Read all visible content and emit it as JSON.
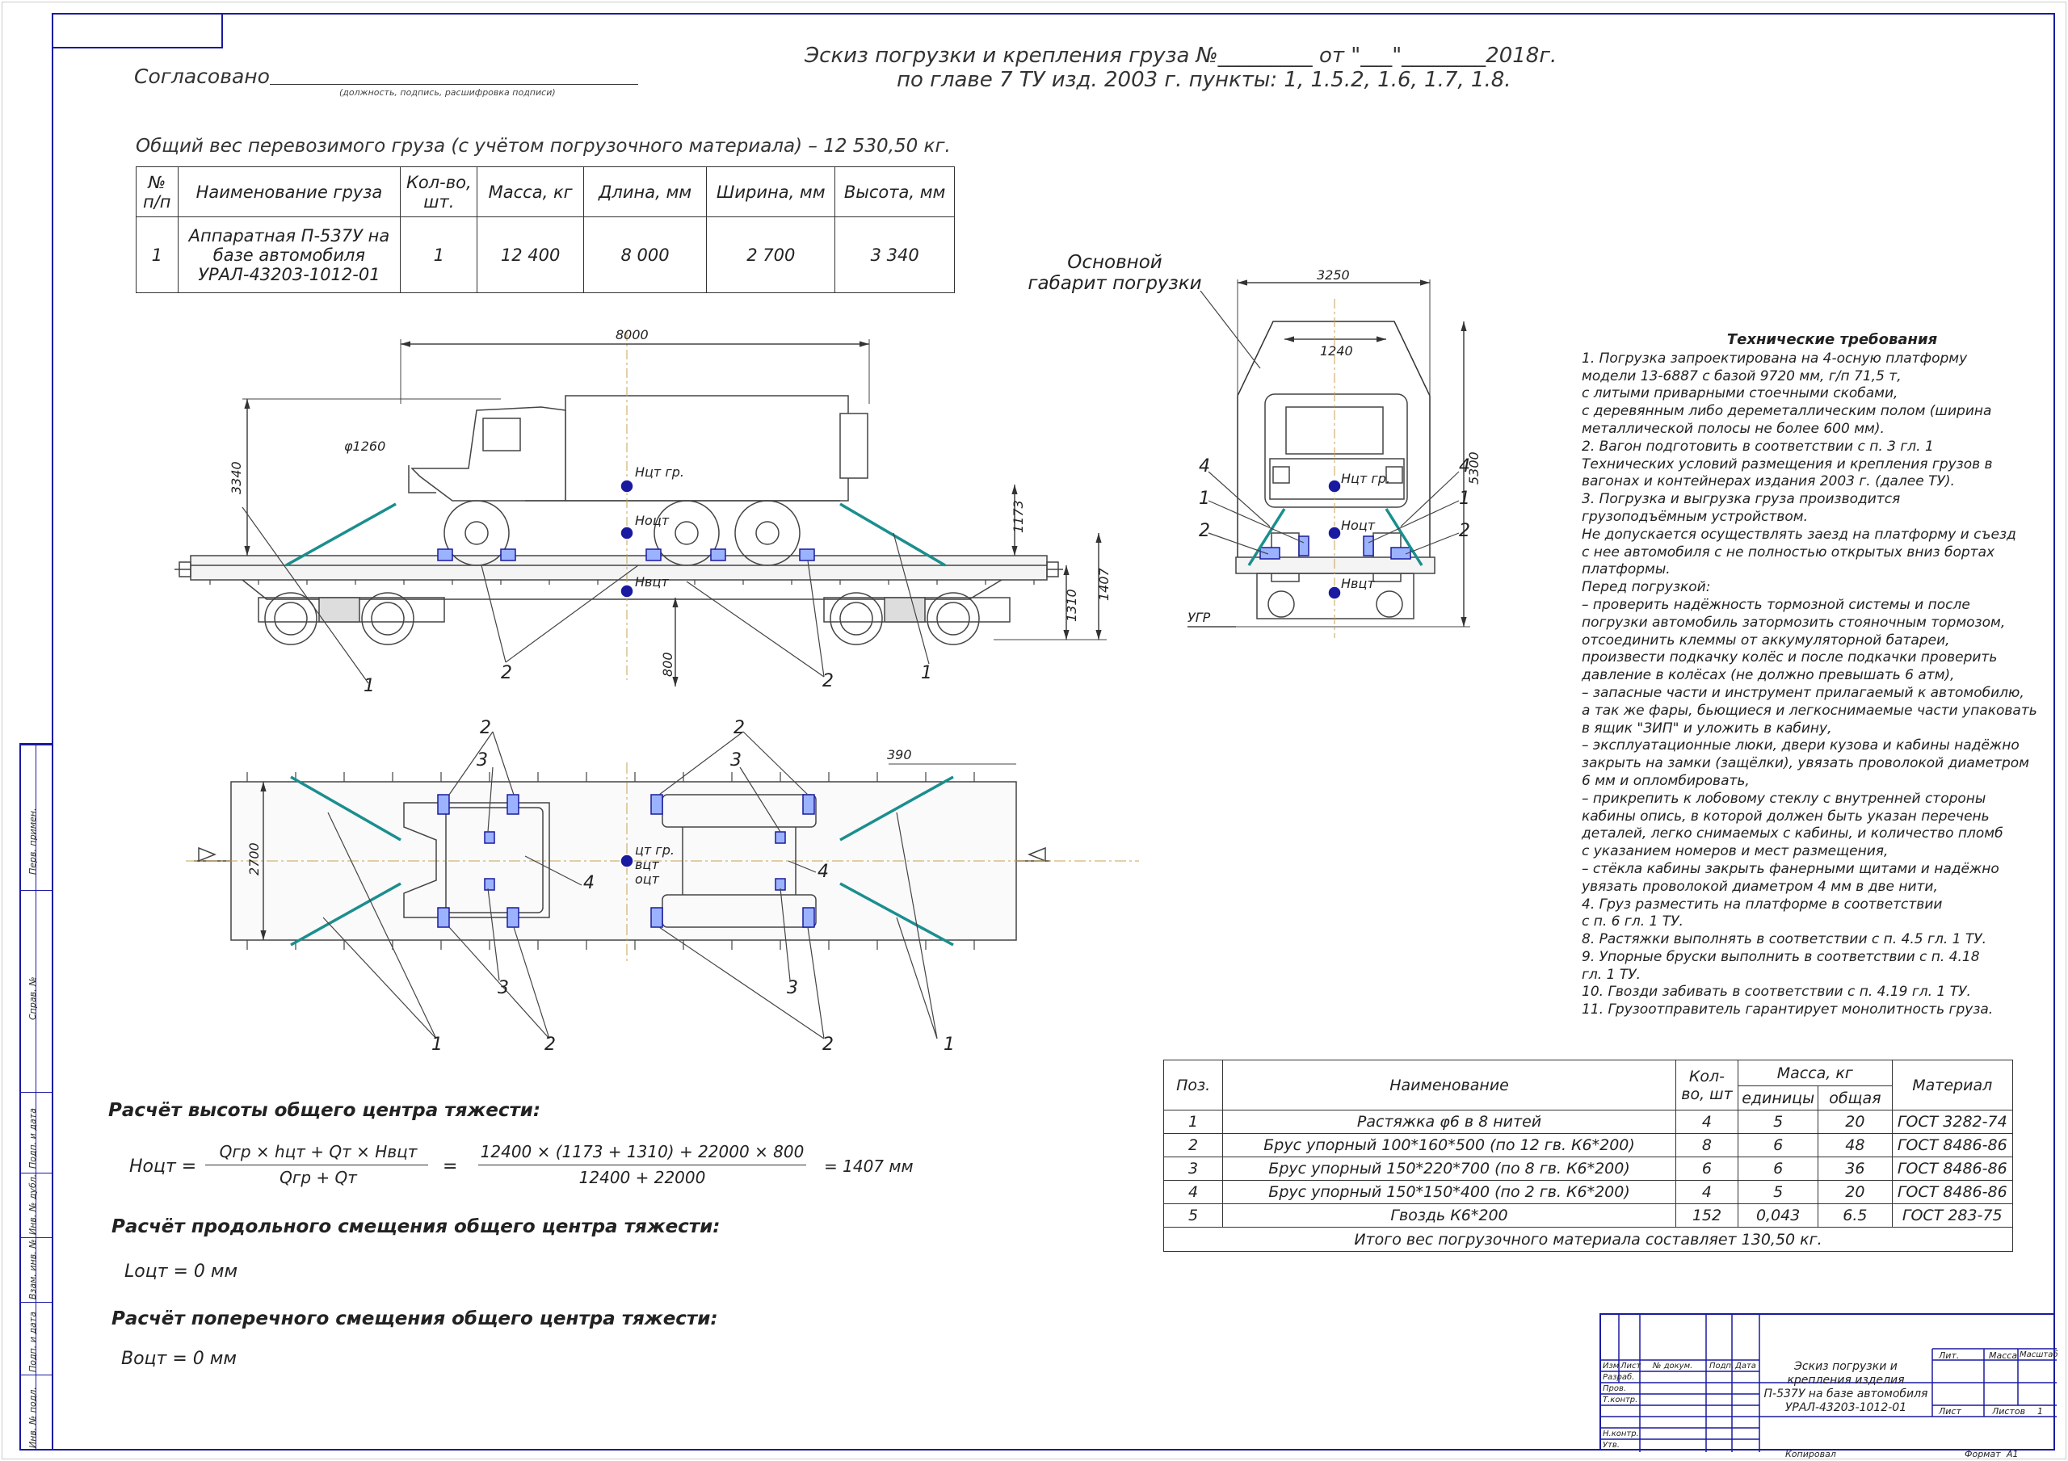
{
  "header": {
    "soglasovano": "Согласовано",
    "sign_hint": "(должность, подпись, расшифровка подписи)",
    "title_line1": "Эскиз погрузки и крепления груза №_________ от \"___\"________2018г.",
    "title_line2": "по главе 7 ТУ изд. 2003 г. пункты: 1, 1.5.2, 1.6, 1.7, 1.8."
  },
  "total_weight": "Общий вес перевозимого груза (с учётом погрузочного материала) – 12 530,50 кг.",
  "cargo_table": {
    "headers": [
      "№ п/п",
      "Наименование груза",
      "Кол-во, шт.",
      "Масса, кг",
      "Длина, мм",
      "Ширина, мм",
      "Высота, мм"
    ],
    "row": [
      "1",
      "Аппаратная П-537У на базе автомобиля УРАЛ-43203-1012-01",
      "1",
      "12 400",
      "8 000",
      "2 700",
      "3 340"
    ]
  },
  "gabarit_label": "Основной габарит погрузки",
  "side_view": {
    "dim_length": "8000",
    "dim_height": "3340",
    "dim_wheel": "φ1260",
    "dim_1173": "1173",
    "dim_1310": "1310",
    "dim_1407": "1407",
    "dim_800": "800",
    "cg_cargo": "Нцт гр.",
    "cg_total": "Ноцт",
    "cg_wagon": "Нвцт"
  },
  "end_view": {
    "dim_width": "3250",
    "dim_top": "1240",
    "dim_height": "5300",
    "ugr": "УГР",
    "cg_cargo": "Нцт гр.",
    "cg_total": "Ноцт",
    "cg_wagon": "Нвцт"
  },
  "plan_view": {
    "dim_width": "2700",
    "dim_390": "390",
    "cg_labels": [
      "цт гр.",
      "вцт",
      "оцт"
    ]
  },
  "tech_requirements": {
    "title": "Технические требования",
    "lines": [
      "1. Погрузка запроектирована на 4-осную платформу",
      "модели 13-6887 с базой 9720 мм, г/п 71,5 т,",
      "с литыми приварными стоечными скобами,",
      "с деревянным либо дереметаллическим полом (ширина",
      "металлической полосы не более 600 мм).",
      "2. Вагон подготовить в соответствии с п. 3 гл. 1",
      "Технических условий размещения и крепления грузов в",
      "вагонах и контейнерах издания 2003 г. (далее ТУ).",
      "3. Погрузка и выгрузка груза производится",
      "грузоподъёмным устройством.",
      "Не допускается осуществлять заезд на платформу и съезд",
      "с нее автомобиля с не полностью открытых вниз бортах",
      "платформы.",
      "Перед погрузкой:",
      "– проверить надёжность тормозной системы и после",
      "погрузки автомобиль затормозить стояночным тормозом,",
      "отсоединить клеммы от аккумуляторной батареи,",
      "произвести подкачку колёс и после подкачки проверить",
      "давление в колёсах (не должно превышать 6 атм),",
      "– запасные части и инструмент прилагаемый к автомобилю,",
      "а так же фары, бьющиеся и легкоснимаемые части упаковать",
      "в ящик \"ЗИП\" и уложить в кабину,",
      "– эксплуатационные люки, двери кузова и кабины надёжно",
      "закрыть на замки (защёлки), увязать проволокой диаметром",
      "6 мм и опломбировать,",
      "– прикрепить к лобовому стеклу с внутренней стороны",
      "кабины опись, в которой должен быть указан перечень",
      "деталей, легко снимаемых с кабины, и количество пломб",
      "с указанием номеров и мест размещения,",
      "– стёкла кабины закрыть фанерными щитами и надёжно",
      "увязать проволокой диаметром 4 мм в две нити,",
      "4. Груз разместить на платформе в соответствии",
      "с п. 6 гл. 1 ТУ.",
      "8. Растяжки выполнять в соответствии с п. 4.5 гл. 1 ТУ.",
      "9. Упорные бруски выполнить в соответствии с п. 4.18",
      "гл. 1 ТУ.",
      "10. Гвозди забивать в соответствии с п. 4.19 гл. 1 ТУ.",
      "11. Грузоотправитель гарантирует монолитность груза."
    ]
  },
  "materials_table": {
    "h_pos": "Поз.",
    "h_name": "Наименование",
    "h_qty": "Кол-во, шт",
    "h_mass": "Масса, кг",
    "h_unit": "единицы",
    "h_total": "общая",
    "h_material": "Материал",
    "rows": [
      [
        "1",
        "Растяжка φ6 в 8 нитей",
        "4",
        "5",
        "20",
        "ГОСТ 3282-74"
      ],
      [
        "2",
        "Брус упорный 100*160*500 (по 12 гв. К6*200)",
        "8",
        "6",
        "48",
        "ГОСТ 8486-86"
      ],
      [
        "3",
        "Брус упорный 150*220*700 (по 8 гв. К6*200)",
        "6",
        "6",
        "36",
        "ГОСТ 8486-86"
      ],
      [
        "4",
        "Брус упорный 150*150*400 (по 2 гв. К6*200)",
        "4",
        "5",
        "20",
        "ГОСТ 8486-86"
      ],
      [
        "5",
        "Гвоздь К6*200",
        "152",
        "0,043",
        "6.5",
        "ГОСТ 283-75"
      ]
    ],
    "footer": "Итого вес погрузочного материала составляет 130,50 кг."
  },
  "calculations": {
    "h_title": "Расчёт высоты общего центра тяжести:",
    "h_lhs": "Ноцт =",
    "h_num": "Qгр × hцт + Qт × Нвцт",
    "h_den": "Qгр + Qт",
    "h_eq": "=",
    "h_num2": "12400 × (1173 + 1310) + 22000 × 800",
    "h_den2": "12400 + 22000",
    "h_res": "= 1407 мм",
    "l_title": "Расчёт продольного смещения общего центра тяжести:",
    "l_val": "Lоцт = 0 мм",
    "b_title": "Расчёт поперечного смещения общего центра тяжести:",
    "b_val": "Воцт = 0 мм"
  },
  "title_block": {
    "doc_title_1": "Эскиз погрузки и крепления изделия",
    "doc_title_2": "П-537У на базе автомобиля",
    "doc_title_3": "УРАЛ-43203-1012-01",
    "c_izm": "Изм",
    "c_list": "Лист",
    "c_ndoc": "№ докум.",
    "c_podp": "Подп.",
    "c_data": "Дата",
    "r_razrab": "Разраб.",
    "r_prov": "Пров.",
    "r_tkontr": "Т.контр.",
    "r_nkontr": "Н.контр.",
    "r_utv": "Утв.",
    "c_lit": "Лит.",
    "c_massa": "Масса",
    "c_masshtab": "Масштаб",
    "c_sheet": "Лист",
    "c_sheets": "Листов",
    "sheets_val": "1",
    "kopiroval": "Копировал",
    "format": "Формат",
    "format_val": "А1"
  },
  "left_strip": [
    "Перв. примен.",
    "Справ. №",
    "Подп. и дата",
    "Инв. № дубл.",
    "Взам. инв. №",
    "Подп. и дата",
    "Инв. № подл."
  ]
}
